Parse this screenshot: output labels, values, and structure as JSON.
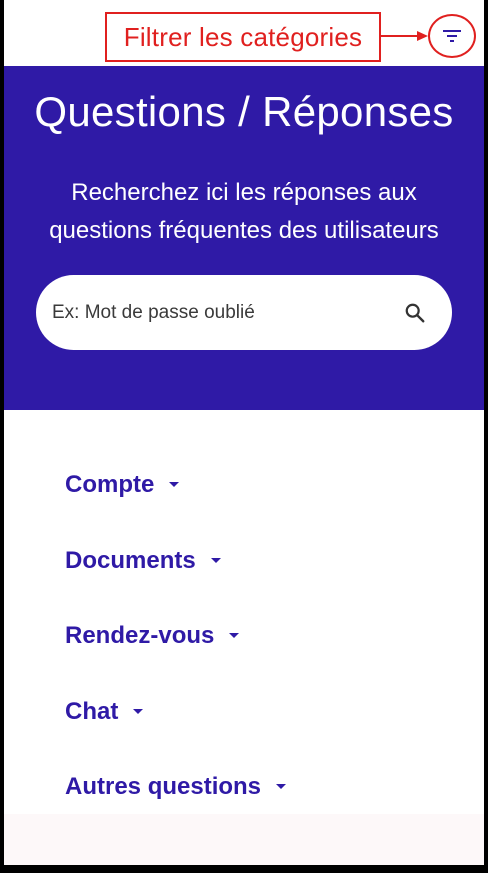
{
  "annotation": {
    "callout_text": "Filtrer les catégories",
    "callout_color": "#e0201f"
  },
  "toolbar": {
    "filter_icon": "filter-list-icon"
  },
  "hero": {
    "title": "Questions / Réponses",
    "subtitle_line1": "Recherchez ici les réponses aux",
    "subtitle_line2": "questions fréquentes des utilisateurs",
    "background_color": "#2f1aa6"
  },
  "search": {
    "placeholder": "Ex: Mot de passe oublié",
    "icon": "search-icon"
  },
  "categories": [
    {
      "label": "Compte"
    },
    {
      "label": "Documents"
    },
    {
      "label": "Rendez-vous"
    },
    {
      "label": "Chat"
    },
    {
      "label": "Autres questions"
    }
  ],
  "colors": {
    "accent": "#2f1aa6",
    "background": "#ffffff"
  }
}
